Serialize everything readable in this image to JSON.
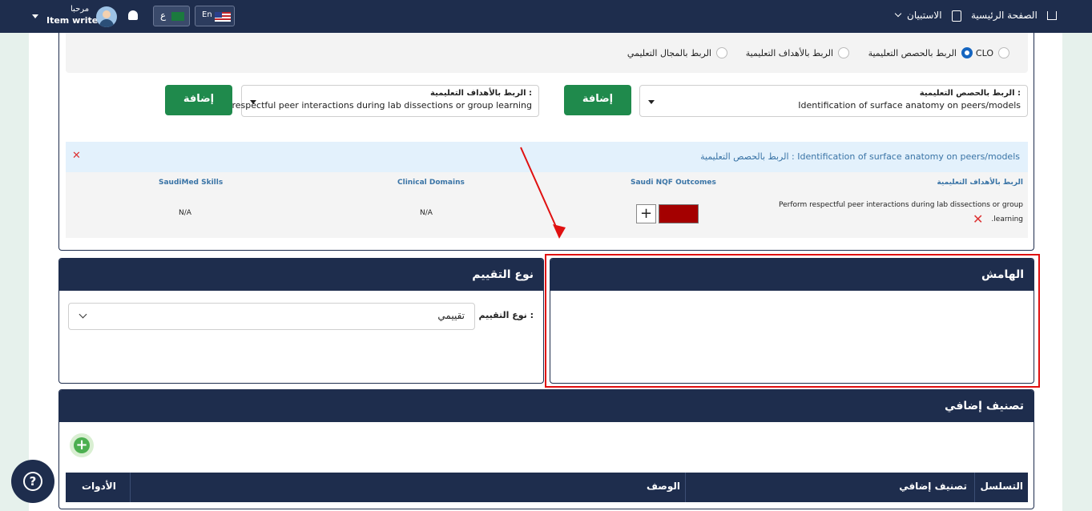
{
  "topbar": {
    "home_label": "الصفحة الرئيسية",
    "survey_label": "الاستبيان",
    "greeting": "مرحبا",
    "user_role": "Item writer",
    "lang_en": "En",
    "lang_ar": "ع"
  },
  "linking": {
    "radios": [
      {
        "label": "CLO",
        "selected": false
      },
      {
        "label": "الربط بالحصص التعليمية",
        "selected": true
      },
      {
        "label": "الربط بالأهداف التعليمية",
        "selected": false
      },
      {
        "label": "الربط بالمجال التعليمي",
        "selected": false
      }
    ],
    "lessons_select": {
      "label": "الربط بالحصص التعليمية :",
      "value": "Identification of surface anatomy on peers/models"
    },
    "objectives_select": {
      "label": "الربط بالأهداف التعليمية :",
      "value": "... respectful peer interactions during lab dissections or group learning"
    },
    "add_label": "إضافة"
  },
  "mapping": {
    "header_text": "الربط بالحصص التعليمية : Identification of surface anatomy on peers/models",
    "columns": [
      "الربط بالأهداف التعليمية",
      "Saudi NQF Outcomes",
      "Clinical Domains",
      "SaudiMed Skills"
    ],
    "objective_text_line1": "Perform respectful peer interactions during lab dissections or group",
    "objective_text_line2": ".learning",
    "clinical_domains": "N/A",
    "saudimed_skills": "N/A",
    "nqf_color": "#a40000"
  },
  "margin_panel": {
    "title": "الهامش"
  },
  "assessment_panel": {
    "title": "نوع التقييم",
    "field_label": "نوع التقييم :",
    "field_value": "تقييمي"
  },
  "extra_panel": {
    "title": "تصنيف إضافي",
    "table_headers": [
      "التسلسل",
      "تصنيف إضافي",
      "الوصف",
      "الأدوات"
    ]
  },
  "colors": {
    "primary": "#1e2d4d",
    "green": "#1f8a4c",
    "annotation": "#e01010"
  }
}
